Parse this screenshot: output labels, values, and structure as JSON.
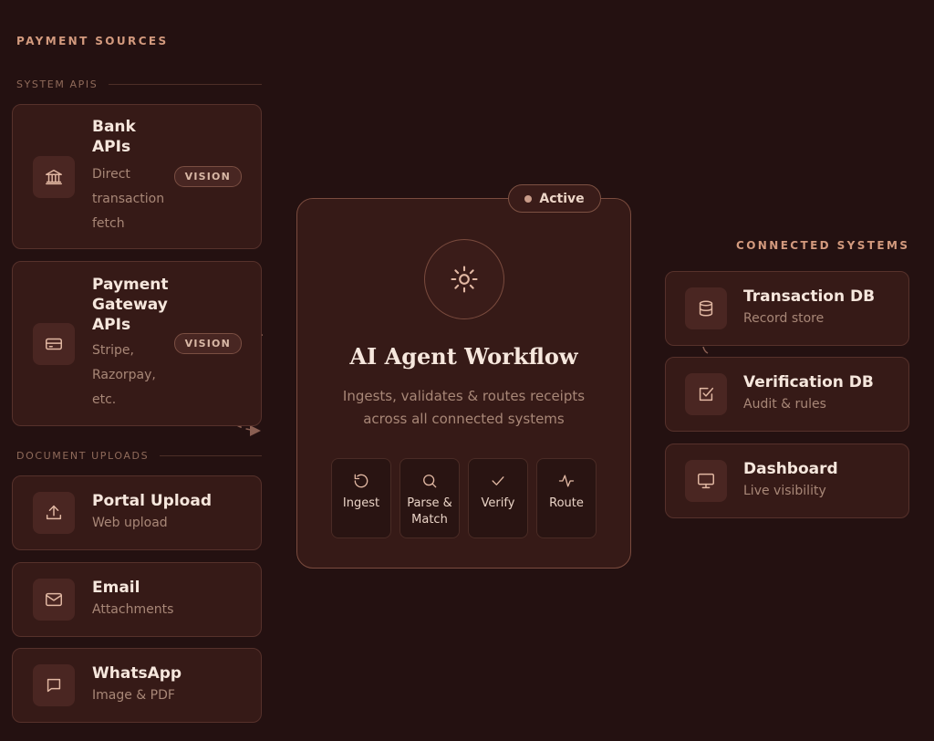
{
  "sources": {
    "title": "PAYMENT SOURCES",
    "system_apis_label": "SYSTEM APIS",
    "document_uploads_label": "DOCUMENT UPLOADS",
    "items": [
      {
        "title": "Bank APIs",
        "subtitle": "Direct transaction fetch",
        "badge": "VISION",
        "icon": "bank-icon"
      },
      {
        "title": "Payment Gateway APIs",
        "subtitle": "Stripe, Razorpay, etc.",
        "badge": "VISION",
        "icon": "card-icon"
      },
      {
        "title": "Portal Upload",
        "subtitle": "Web upload",
        "icon": "upload-icon"
      },
      {
        "title": "Email",
        "subtitle": "Attachments",
        "icon": "mail-icon"
      },
      {
        "title": "WhatsApp",
        "subtitle": "Image & PDF",
        "icon": "chat-icon"
      }
    ]
  },
  "agent": {
    "status": "Active",
    "title": "AI Agent Workflow",
    "description_line1": "Ingests, validates & routes receipts",
    "description_line2": "across all connected systems",
    "icon": "sun-icon",
    "steps": [
      {
        "label": "Ingest",
        "icon": "refresh-icon"
      },
      {
        "label": "Parse & Match",
        "icon": "search-icon"
      },
      {
        "label": "Verify",
        "icon": "check-icon"
      },
      {
        "label": "Route",
        "icon": "pulse-icon"
      }
    ]
  },
  "connected": {
    "title": "CONNECTED SYSTEMS",
    "items": [
      {
        "title": "Transaction DB",
        "subtitle": "Record store",
        "icon": "database-icon"
      },
      {
        "title": "Verification DB",
        "subtitle": "Audit & rules",
        "icon": "checkbox-icon"
      },
      {
        "title": "Dashboard",
        "subtitle": "Live visibility",
        "icon": "monitor-icon"
      }
    ]
  },
  "colors": {
    "background": "#241111",
    "card": "#361a17",
    "accent": "#d39a7e"
  }
}
